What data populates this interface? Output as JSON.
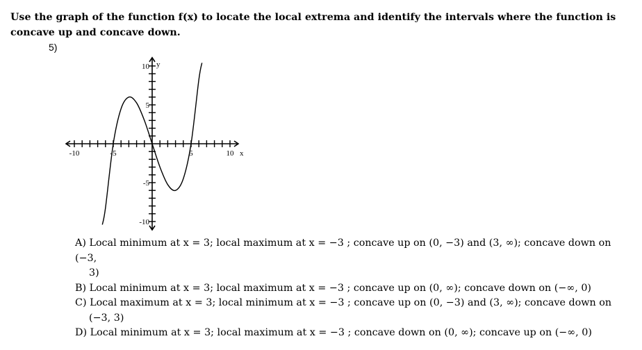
{
  "question": {
    "text": "Use the graph of the function f(x) to locate the local extrema and identify the intervals where the function is concave up and concave down.",
    "number": "5)"
  },
  "chart_data": {
    "type": "line",
    "title": "",
    "xlabel": "x",
    "ylabel": "y",
    "xlim": [
      -10,
      10
    ],
    "ylim": [
      -10,
      10
    ],
    "x_tick_labels": [
      "-10",
      "-5",
      "5",
      "10"
    ],
    "y_tick_labels": [
      "10",
      "5",
      "-5",
      "-10"
    ],
    "grid": false,
    "series": [
      {
        "name": "f(x)",
        "description": "cubic with roots at -5, 0, 5; local max near (-3, 6); local min near (3, -6)",
        "x": [
          -6.4,
          -6,
          -5,
          -4,
          -3,
          -2,
          -1,
          0,
          1,
          2,
          3,
          4,
          5,
          6,
          6.4
        ],
        "y": [
          -10.4,
          -8.25,
          0,
          4.5,
          6,
          5.25,
          3,
          0,
          -3,
          -5.25,
          -6,
          -4.5,
          0,
          8.25,
          10.4
        ]
      }
    ]
  },
  "choices": [
    {
      "label": "A)",
      "line1": "Local minimum at  x = 3; local maximum at x = −3 ; concave up on (0, −3) and (3, ∞); concave down on (−3,",
      "line2": "3)"
    },
    {
      "label": "B)",
      "line1": "Local minimum at  x = 3; local maximum at x = −3 ; concave up on (0, ∞); concave down on (−∞, 0)",
      "line2": ""
    },
    {
      "label": "C)",
      "line1": "Local maximum at  x = 3; local minimum at x = −3 ; concave up on (0, −3) and (3, ∞); concave down on",
      "line2": "(−3, 3)"
    },
    {
      "label": "D)",
      "line1": "Local minimum at  x = 3; local maximum at x = −3 ; concave down on (0, ∞); concave up on (−∞, 0)",
      "line2": ""
    }
  ]
}
